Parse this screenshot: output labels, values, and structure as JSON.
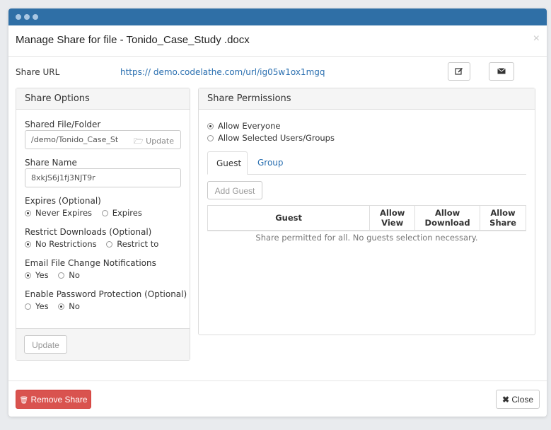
{
  "modal": {
    "title": "Manage Share for file - Tonido_Case_Study .docx",
    "close_glyph": "×"
  },
  "share_url": {
    "label": "Share URL",
    "url": "https:// demo.codelathe.com/url/ig05w1ox1mgq",
    "edit_icon": "edit-icon",
    "email_icon": "envelope-icon"
  },
  "options": {
    "header": "Share Options",
    "shared_file_label": "Shared File/Folder",
    "shared_file_value": "/demo/Tonido_Case_St",
    "update_addon_label": "Update",
    "share_name_label": "Share Name",
    "share_name_value": "8xkjS6j1fj3NJT9r",
    "expires": {
      "label": "Expires (Optional)",
      "options": [
        "Never Expires",
        "Expires"
      ],
      "selected": "Never Expires"
    },
    "restrict": {
      "label": "Restrict Downloads (Optional)",
      "options": [
        "No Restrictions",
        "Restrict to"
      ],
      "selected": "No Restrictions"
    },
    "email_notify": {
      "label": "Email File Change Notifications",
      "options": [
        "Yes",
        "No"
      ],
      "selected": "Yes"
    },
    "password": {
      "label": "Enable Password Protection (Optional)",
      "options": [
        "Yes",
        "No"
      ],
      "selected": "No"
    },
    "update_button": "Update"
  },
  "permissions": {
    "header": "Share Permissions",
    "access_options": [
      "Allow Everyone",
      "Allow Selected Users/Groups"
    ],
    "access_selected": "Allow Everyone",
    "tabs": [
      "Guest",
      "Group"
    ],
    "active_tab": "Guest",
    "add_guest_button": "Add Guest",
    "table_headers": [
      "Guest",
      "Allow View",
      "Allow Download",
      "Allow Share"
    ],
    "empty_message": "Share permitted for all. No guests selection necessary."
  },
  "footer": {
    "remove_button": "Remove Share",
    "close_button": "Close"
  },
  "colors": {
    "titlebar": "#2f6fa6",
    "link": "#2a6fb0",
    "danger": "#d9534f"
  }
}
